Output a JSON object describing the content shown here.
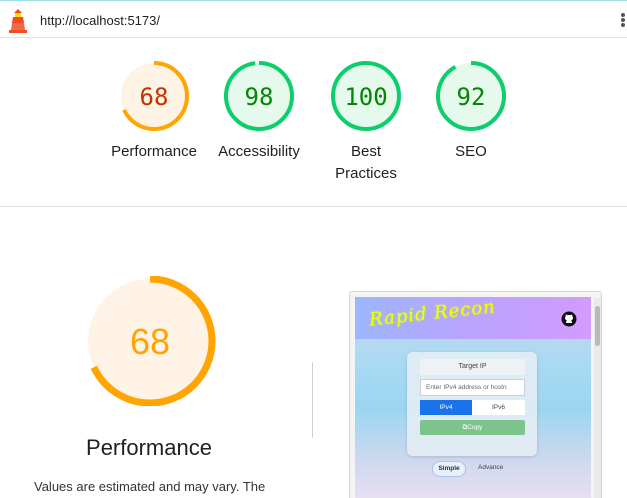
{
  "browser": {
    "url": "http://localhost:5173/"
  },
  "colors": {
    "average": "#ffa400",
    "average_text": "#c33300",
    "average_bg": "#fff3e5",
    "pass": "#0cce6b",
    "pass_text": "#008800",
    "pass_bg": "#e5f9ec"
  },
  "gauges": [
    {
      "score": "68",
      "label": "Performance",
      "level": 0.68,
      "status": "average"
    },
    {
      "score": "98",
      "label": "Accessibility",
      "level": 0.98,
      "status": "pass"
    },
    {
      "score": "100",
      "label_line1": "Best",
      "label_line2": "Practices",
      "level": 1.0,
      "status": "pass"
    },
    {
      "score": "92",
      "label": "SEO",
      "level": 0.92,
      "status": "pass"
    }
  ],
  "performance": {
    "score": "68",
    "level": 0.68,
    "title": "Performance",
    "description": "Values are estimated and may vary. The"
  },
  "screenshot": {
    "logo_text": "Rapid Recon",
    "card_title": "Target IP",
    "input_placeholder": "Enter IPv4 address or hostn",
    "tab_ipv4": "IPv4",
    "tab_ipv6": "IPv6",
    "copy_label": "Copy",
    "mode_simple": "Simple",
    "mode_advance": "Advance"
  }
}
